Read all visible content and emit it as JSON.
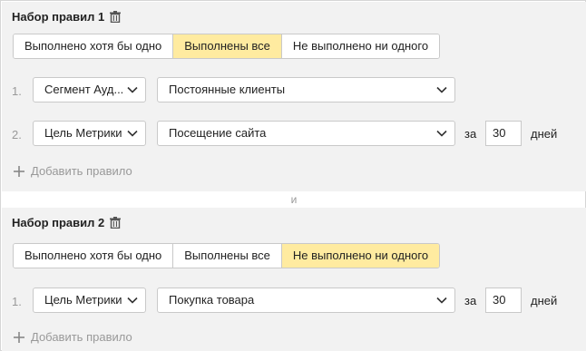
{
  "rulesets": [
    {
      "title": "Набор правил 1",
      "modes": [
        {
          "label": "Выполнено хотя бы одно",
          "active": false
        },
        {
          "label": "Выполнены все",
          "active": true
        },
        {
          "label": "Не выполнено ни одного",
          "active": false
        }
      ],
      "rules": [
        {
          "number": "1.",
          "type": "Сегмент Ауд...",
          "value": "Постоянные клиенты"
        },
        {
          "number": "2.",
          "type": "Цель Метрики",
          "value": "Посещение сайта",
          "period_prefix": "за",
          "period_value": "30",
          "period_unit": "дней"
        }
      ],
      "add_rule": "Добавить правило"
    },
    {
      "title": "Набор правил 2",
      "modes": [
        {
          "label": "Выполнено хотя бы одно",
          "active": false
        },
        {
          "label": "Выполнены все",
          "active": false
        },
        {
          "label": "Не выполнено ни одного",
          "active": true
        }
      ],
      "rules": [
        {
          "number": "1.",
          "type": "Цель Метрики",
          "value": "Покупка товара",
          "period_prefix": "за",
          "period_value": "30",
          "period_unit": "дней"
        }
      ],
      "add_rule": "Добавить правило"
    }
  ],
  "separator": "и",
  "colors": {
    "active_mode": "#ffeba0",
    "panel_bg": "#f2f2f2",
    "muted_text": "#999999"
  },
  "icons": {
    "delete": "trash-icon",
    "dropdown": "chevron-down-icon",
    "add": "plus-icon"
  }
}
